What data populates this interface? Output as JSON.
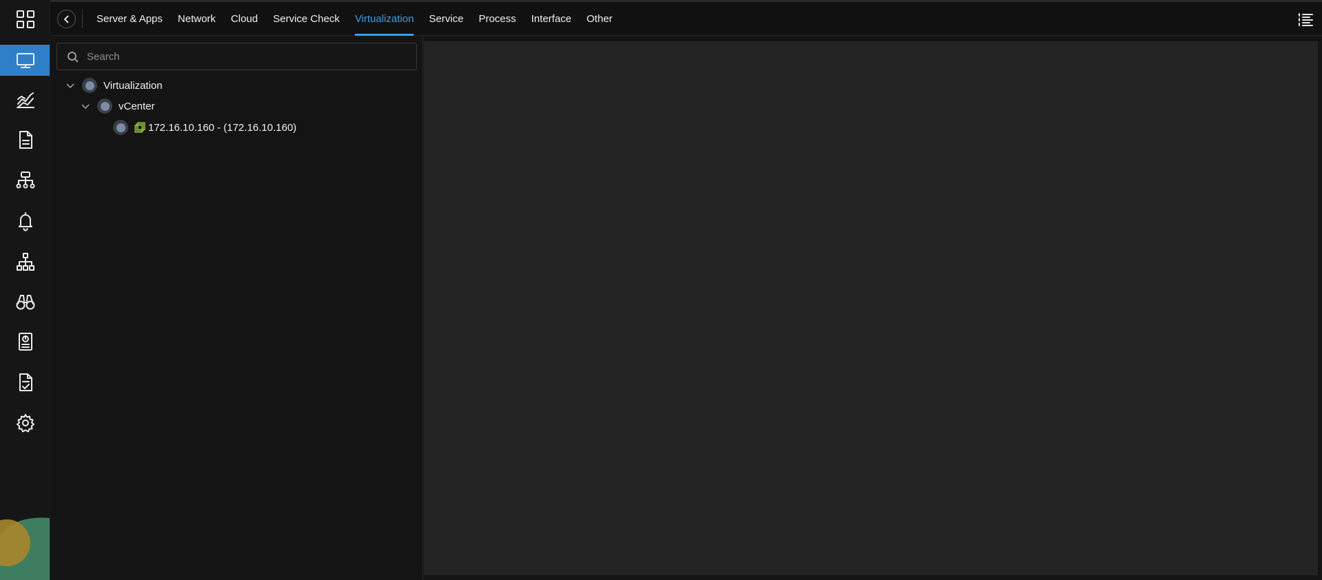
{
  "nav": {
    "tabs": [
      {
        "label": "Server & Apps"
      },
      {
        "label": "Network"
      },
      {
        "label": "Cloud"
      },
      {
        "label": "Service Check"
      },
      {
        "label": "Virtualization"
      },
      {
        "label": "Service"
      },
      {
        "label": "Process"
      },
      {
        "label": "Interface"
      },
      {
        "label": "Other"
      }
    ],
    "active_tab": "Virtualization"
  },
  "sidebar": {
    "icons": [
      "grid-apps-icon",
      "monitor-icon",
      "chart-trend-icon",
      "document-icon",
      "network-topology-icon",
      "bell-icon",
      "hierarchy-icon",
      "binoculars-icon",
      "report-icon",
      "checklist-icon",
      "gear-icon"
    ],
    "active": "monitor-icon"
  },
  "search": {
    "placeholder": "Search"
  },
  "tree": {
    "root": {
      "label": "Virtualization"
    },
    "group": {
      "label": "vCenter"
    },
    "host": {
      "label": "172.16.10.160 - (172.16.10.160)"
    }
  },
  "colors": {
    "accent": "#3a9fe8",
    "active_rail": "#2f7fc8",
    "vm_icon": "#8fc23a",
    "status_dot": "#7c8ca6"
  }
}
